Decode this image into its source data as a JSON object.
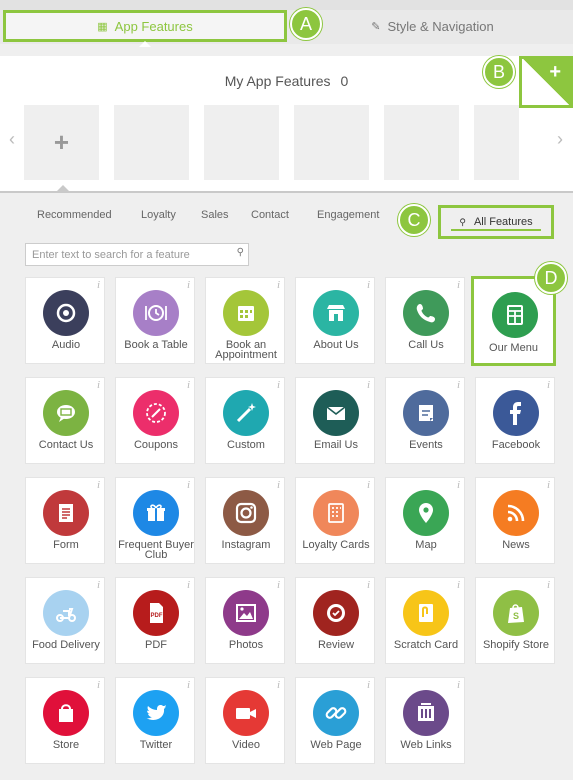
{
  "tabs": {
    "app_features": "App Features",
    "style_navigation": "Style & Navigation"
  },
  "callouts": {
    "a": "A",
    "b": "B",
    "c": "C",
    "d": "D"
  },
  "my_features": {
    "title": "My App Features",
    "count": "0",
    "add_symbol": "+",
    "prev_arrow": "‹",
    "next_arrow": "›"
  },
  "categories": {
    "items": [
      "Recommended",
      "Loyalty",
      "Sales",
      "Contact",
      "Engagement"
    ],
    "all": "All Features"
  },
  "search": {
    "placeholder": "Enter text to search for a feature"
  },
  "info_glyph": "i",
  "features": [
    {
      "label": "Audio",
      "color": "#3b3f5c",
      "icon": "audio-icon"
    },
    {
      "label": "Book a Table",
      "color": "#a77fc7",
      "icon": "book-table-icon"
    },
    {
      "label": "Book an Appointment",
      "color": "#a4c639",
      "icon": "calendar-icon"
    },
    {
      "label": "About Us",
      "color": "#2bb5a3",
      "icon": "store-front-icon"
    },
    {
      "label": "Call Us",
      "color": "#3f9a5a",
      "icon": "phone-icon"
    },
    {
      "label": "Our Menu",
      "color": "#2e9e50",
      "icon": "menu-icon"
    },
    {
      "label": "Contact Us",
      "color": "#7cb342",
      "icon": "chat-icon"
    },
    {
      "label": "Coupons",
      "color": "#ec2e6b",
      "icon": "coupon-icon"
    },
    {
      "label": "Custom",
      "color": "#1fa8b0",
      "icon": "magic-wand-icon"
    },
    {
      "label": "Email Us",
      "color": "#1e5d57",
      "icon": "envelope-icon"
    },
    {
      "label": "Events",
      "color": "#4f6b9c",
      "icon": "events-icon"
    },
    {
      "label": "Facebook",
      "color": "#3b5998",
      "icon": "facebook-icon"
    },
    {
      "label": "Form",
      "color": "#c0393b",
      "icon": "form-icon"
    },
    {
      "label": "Frequent Buyer Club",
      "color": "#1e88e5",
      "icon": "gift-icon"
    },
    {
      "label": "Instagram",
      "color": "#8d5a45",
      "icon": "instagram-icon"
    },
    {
      "label": "Loyalty Cards",
      "color": "#f0875a",
      "icon": "loyalty-card-icon"
    },
    {
      "label": "Map",
      "color": "#3aa655",
      "icon": "map-pin-icon"
    },
    {
      "label": "News",
      "color": "#f57c22",
      "icon": "rss-icon"
    },
    {
      "label": "Food Delivery",
      "color": "#a8d2f0",
      "icon": "scooter-icon"
    },
    {
      "label": "PDF",
      "color": "#b71c1c",
      "icon": "pdf-icon"
    },
    {
      "label": "Photos",
      "color": "#8e3a8a",
      "icon": "photo-icon"
    },
    {
      "label": "Review",
      "color": "#a0241f",
      "icon": "review-badge-icon"
    },
    {
      "label": "Scratch Card",
      "color": "#f7c518",
      "icon": "scratch-card-icon"
    },
    {
      "label": "Shopify Store",
      "color": "#8fbf45",
      "icon": "shopify-icon"
    },
    {
      "label": "Store",
      "color": "#e0103a",
      "icon": "shopping-bag-icon"
    },
    {
      "label": "Twitter",
      "color": "#1da1f2",
      "icon": "twitter-icon"
    },
    {
      "label": "Video",
      "color": "#e53935",
      "icon": "video-camera-icon"
    },
    {
      "label": "Web Page",
      "color": "#2a9fd6",
      "icon": "link-icon"
    },
    {
      "label": "Web Links",
      "color": "#6b4a8a",
      "icon": "web-links-icon"
    }
  ],
  "colors": {
    "accent": "#8dc63f"
  }
}
